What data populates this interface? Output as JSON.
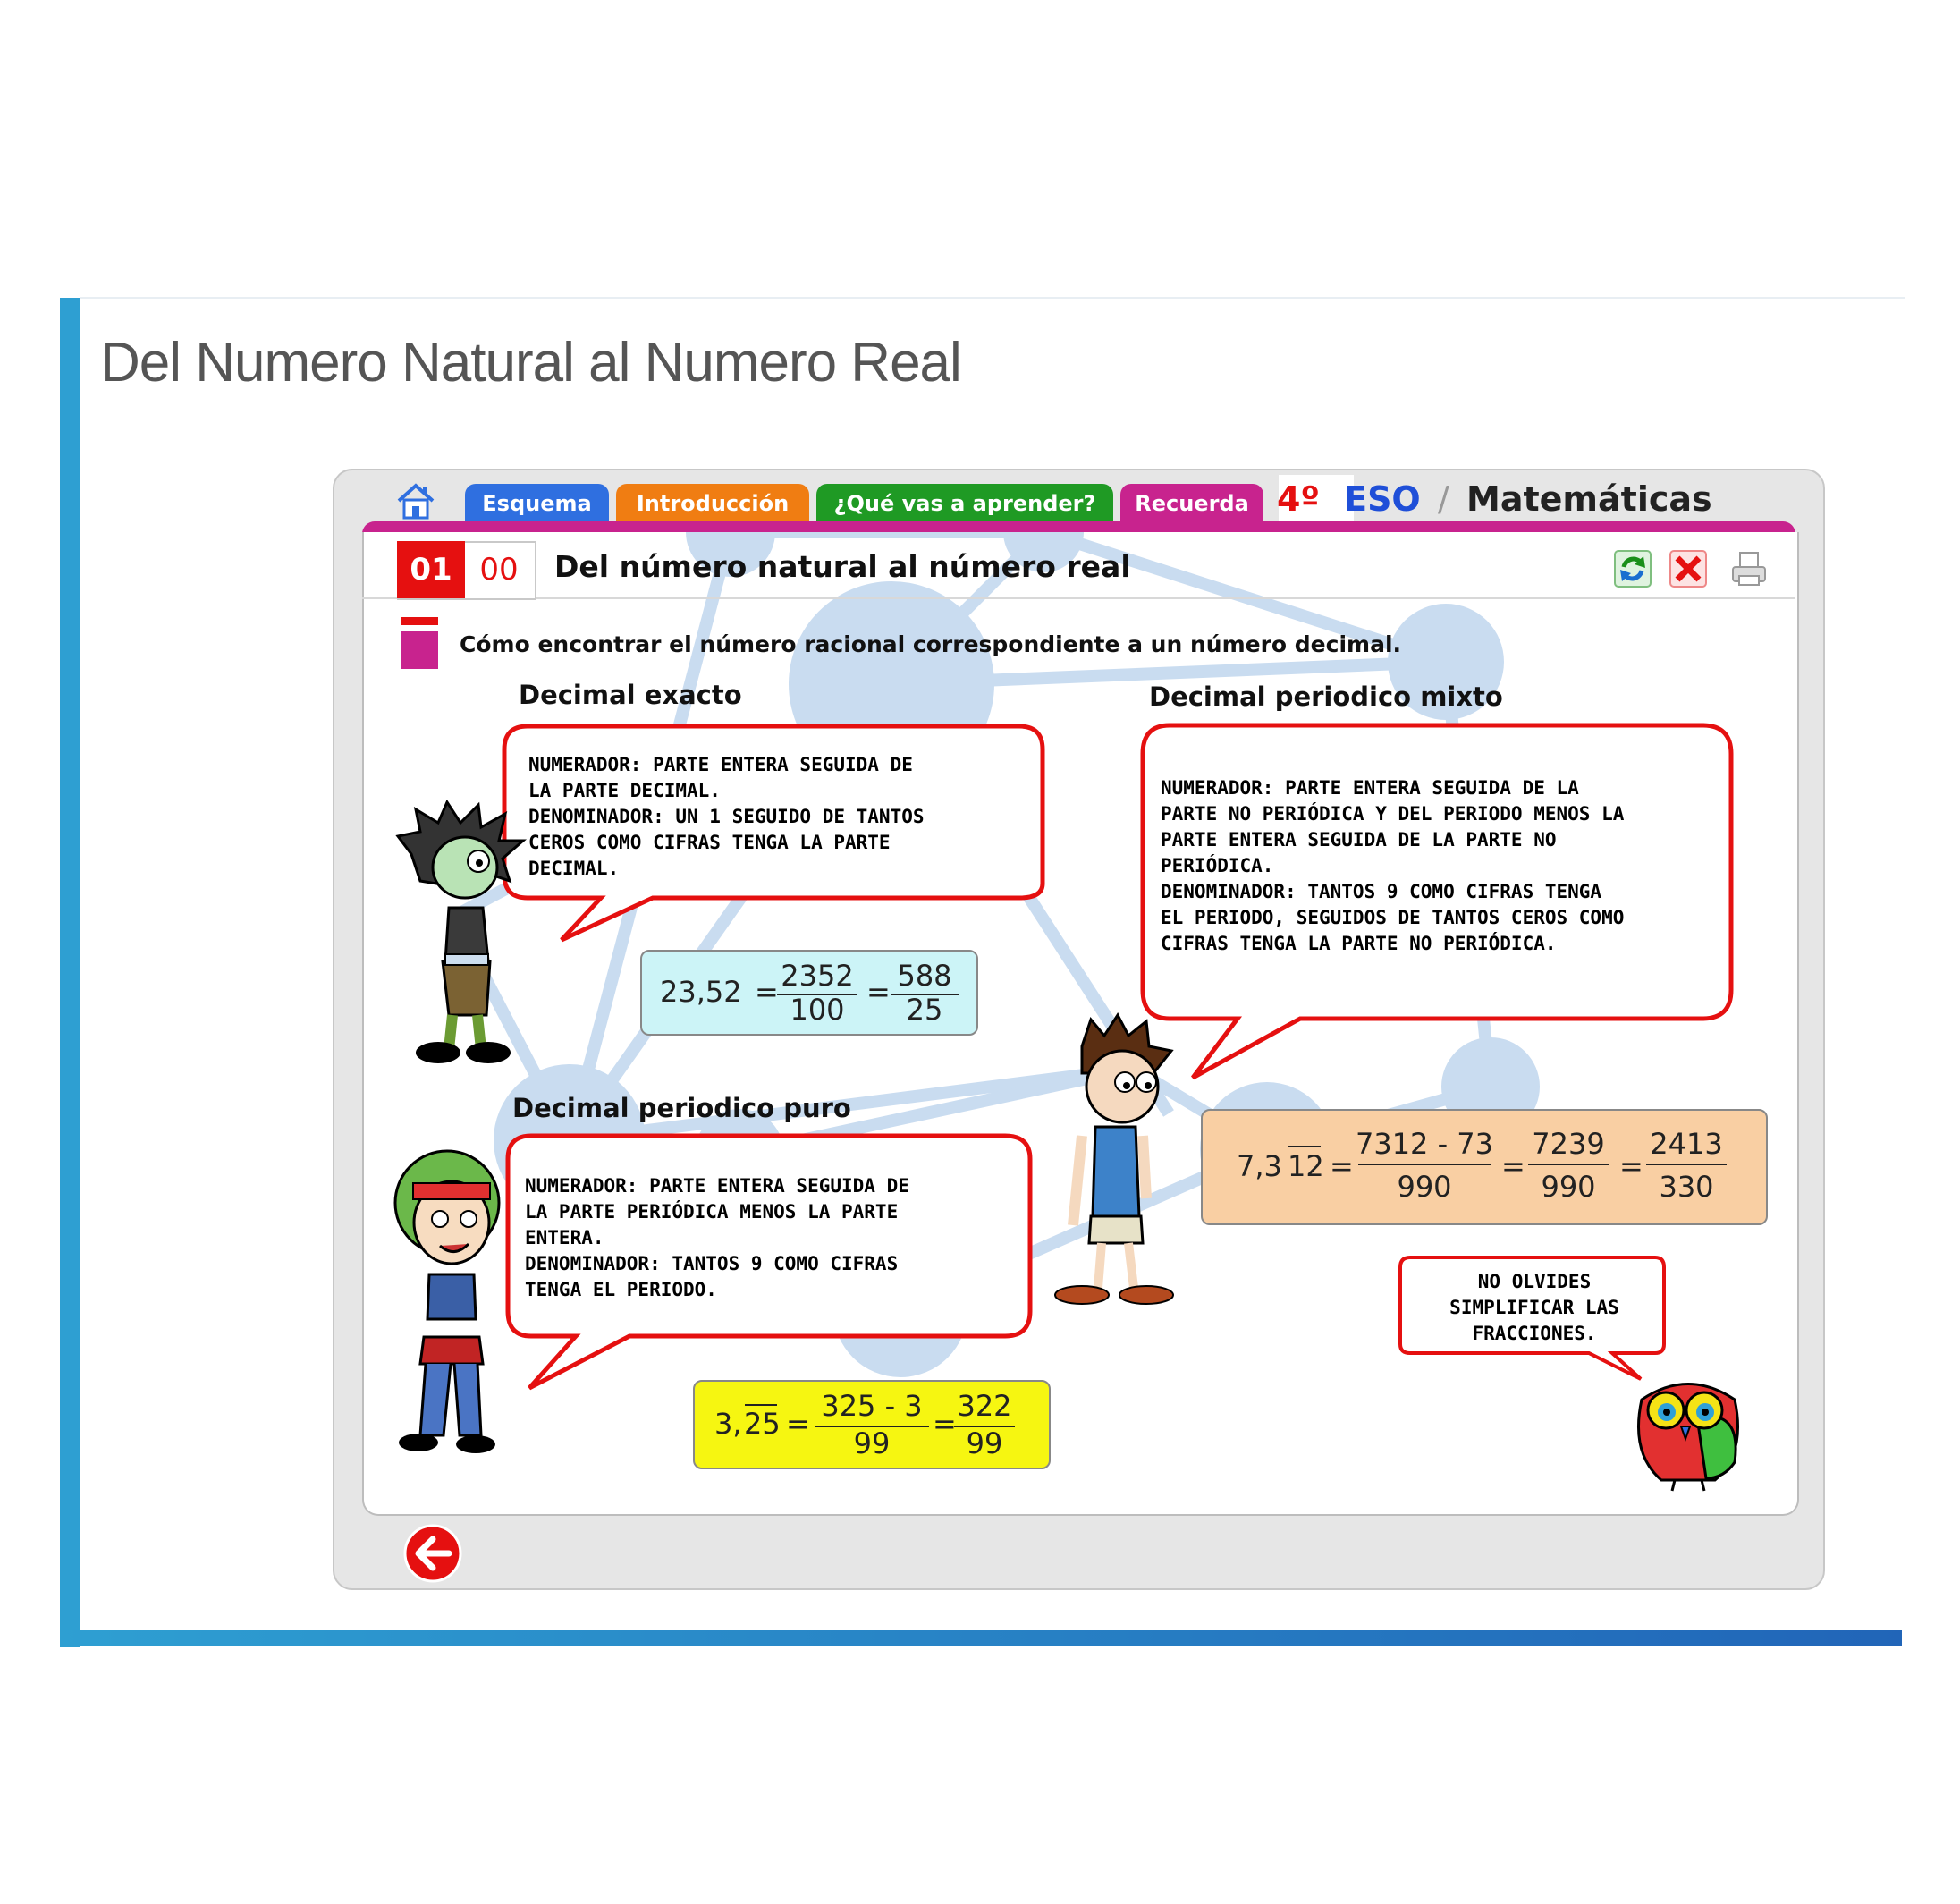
{
  "slide": {
    "title": "Del Numero Natural al Numero Real"
  },
  "nav": {
    "tabs": [
      {
        "label": "Esquema",
        "color": "#2f6fe0"
      },
      {
        "label": "Introducción",
        "color": "#f07d12"
      },
      {
        "label": "¿Qué vas a aprender?",
        "color": "#1f9a24"
      },
      {
        "label": "Recuerda",
        "color": "#c8238e"
      }
    ],
    "home_icon": "home-icon"
  },
  "brand": {
    "grade": "4º",
    "level": "ESO",
    "separator": "/",
    "subject": "Matemáticas"
  },
  "header": {
    "number_main": "01",
    "number_sub": "00",
    "title": "Del número natural al número real",
    "tools": [
      "refresh-icon",
      "close-icon",
      "print-icon"
    ]
  },
  "content": {
    "intro": "Cómo encontrar el número racional correspondiente a un número decimal.",
    "exacto": {
      "heading": "Decimal exacto",
      "bubble": "NUMERADOR: PARTE ENTERA SEGUIDA DE\nLA PARTE DECIMAL.\nDENOMINADOR: UN 1 SEGUIDO DE TANTOS\nCEROS COMO CIFRAS TENGA LA PARTE\nDECIMAL.",
      "eq": {
        "lhs": "23,52",
        "n1": "2352",
        "d1": "100",
        "n2": "588",
        "d2": "25"
      },
      "color": "#ccf4f7"
    },
    "mixto": {
      "heading": "Decimal periodico mixto",
      "bubble": "NUMERADOR: PARTE ENTERA SEGUIDA DE LA\nPARTE NO PERIÓDICA Y DEL PERIODO MENOS LA\nPARTE ENTERA SEGUIDA DE LA PARTE NO\nPERIÓDICA.\nDENOMINADOR: TANTOS 9 COMO CIFRAS TENGA\nEL PERIODO, SEGUIDOS DE TANTOS CEROS COMO\nCIFRAS TENGA LA PARTE NO PERIÓDICA.",
      "eq": {
        "lhs_int": "7,3",
        "lhs_period": "12",
        "n1": "7312 - 73",
        "d1": "990",
        "n2": "7239",
        "d2": "990",
        "n3": "2413",
        "d3": "330"
      },
      "color": "#f9cfa3"
    },
    "puro": {
      "heading": "Decimal periodico puro",
      "bubble": "NUMERADOR: PARTE ENTERA SEGUIDA DE\nLA PARTE PERIÓDICA MENOS LA PARTE\nENTERA.\nDENOMINADOR: TANTOS 9 COMO CIFRAS\nTENGA EL PERIODO.",
      "eq": {
        "lhs_int": "3,",
        "lhs_period": "25",
        "n1": "325 - 3",
        "d1": "99",
        "n2": "322",
        "d2": "99"
      },
      "color": "#f6f611"
    },
    "reminder": "NO OLVIDES\nSIMPLIFICAR LAS\nFRACCIONES."
  },
  "footer": {
    "back_icon": "back-arrow-icon"
  },
  "colors": {
    "accent_blue": "#2e9fd2",
    "magenta": "#c8238e",
    "red": "#e51010"
  }
}
